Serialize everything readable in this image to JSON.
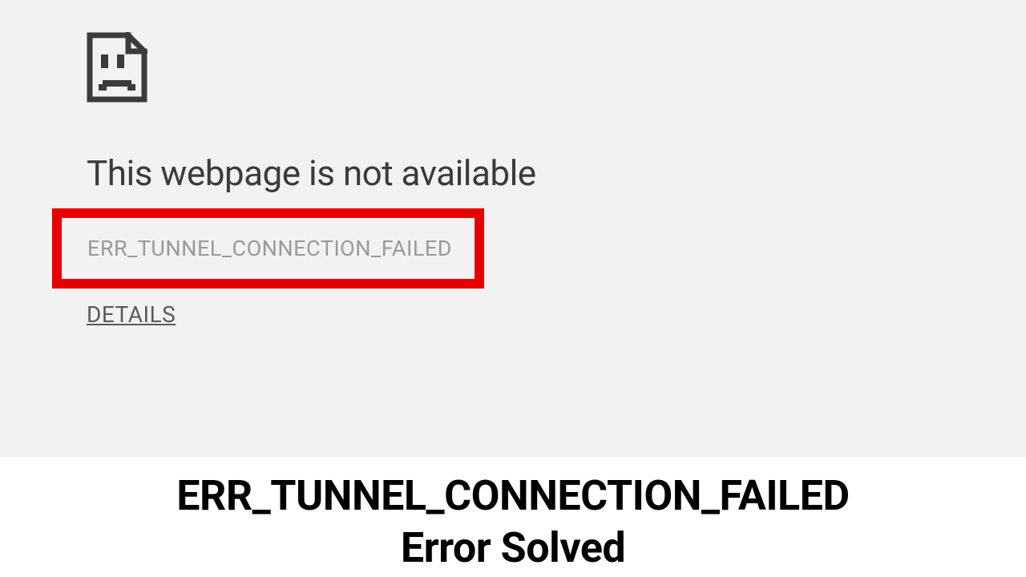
{
  "error": {
    "heading": "This webpage is not available",
    "code": "ERR_TUNNEL_CONNECTION_FAILED",
    "details_link": "DETAILS"
  },
  "caption": {
    "line1": "ERR_TUNNEL_CONNECTION_FAILED",
    "line2": "Error Solved"
  }
}
